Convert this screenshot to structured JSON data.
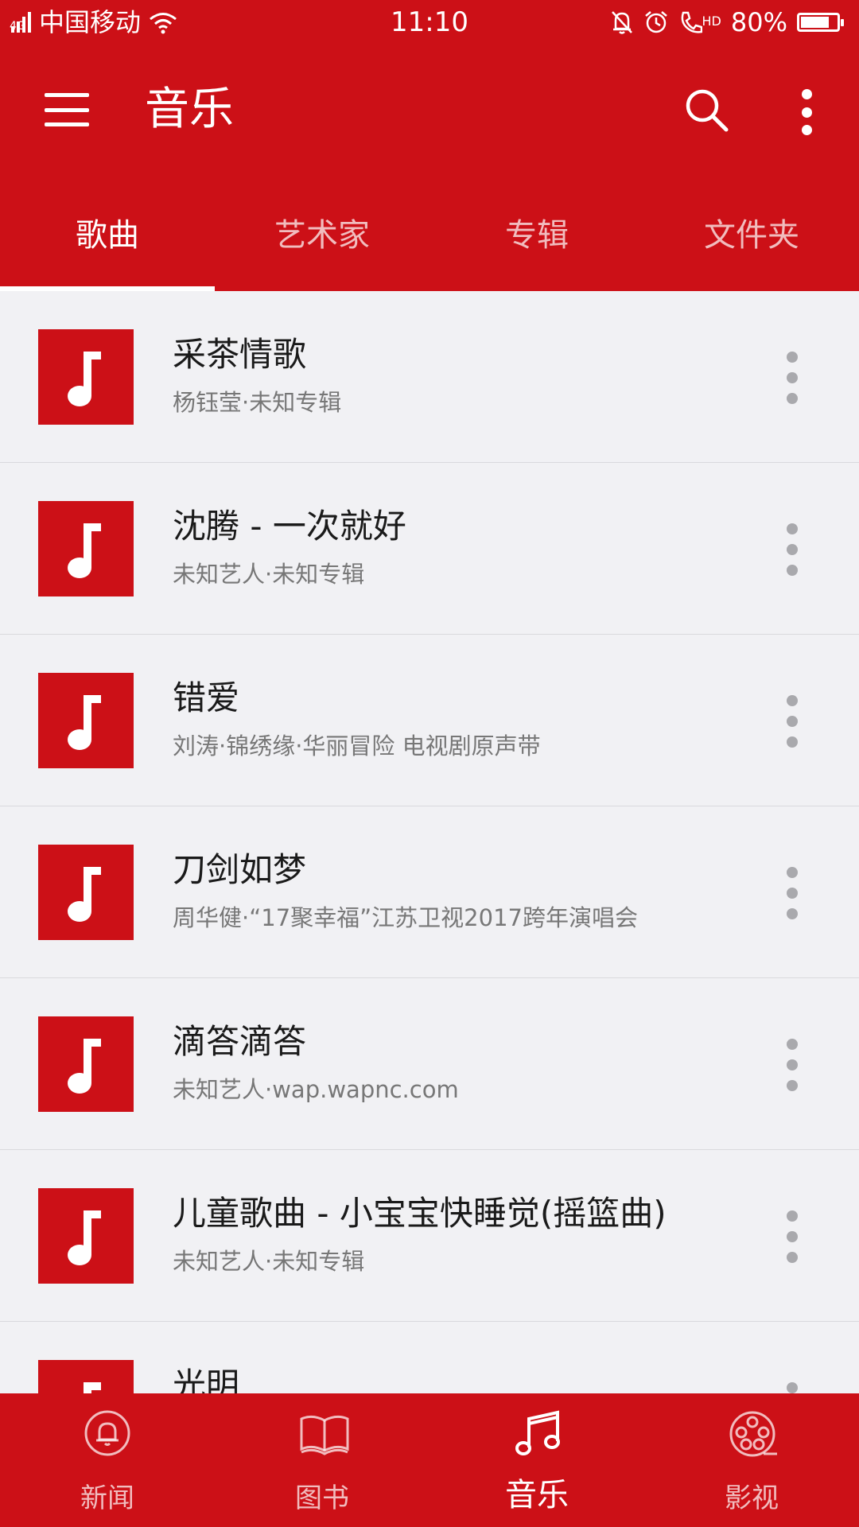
{
  "status_bar": {
    "network_type": "4G",
    "carrier": "中国移动",
    "time": "11:10",
    "hd_label": "HD",
    "battery": "80%",
    "battery_level": 0.8,
    "icons": [
      "signal-icon",
      "wifi-icon",
      "mute-bell-icon",
      "alarm-icon",
      "hd-call-icon",
      "battery-icon"
    ]
  },
  "app_bar": {
    "title": "音乐",
    "icons": [
      "menu-icon",
      "search-icon",
      "more-vertical-icon"
    ]
  },
  "tabs": [
    {
      "label": "歌曲",
      "active": true
    },
    {
      "label": "艺术家",
      "active": false
    },
    {
      "label": "专辑",
      "active": false
    },
    {
      "label": "文件夹",
      "active": false
    }
  ],
  "songs": [
    {
      "title": "采茶情歌",
      "subtitle": "杨钰莹·未知专辑"
    },
    {
      "title": "沈腾 - 一次就好",
      "subtitle": "未知艺人·未知专辑"
    },
    {
      "title": "错爱",
      "subtitle": "刘涛·锦绣缘·华丽冒险 电视剧原声带"
    },
    {
      "title": "刀剑如梦",
      "subtitle": "周华健·“17聚幸福”江苏卫视2017跨年演唱会"
    },
    {
      "title": "滴答滴答",
      "subtitle": "未知艺人·wap.wapnc.com"
    },
    {
      "title": "儿童歌曲 - 小宝宝快睡觉(摇篮曲)",
      "subtitle": "未知艺人·未知专辑"
    },
    {
      "title": "光明",
      "subtitle": ""
    }
  ],
  "bottom_nav": [
    {
      "label": "新闻",
      "icon": "news-bell-icon",
      "active": false
    },
    {
      "label": "图书",
      "icon": "book-icon",
      "active": false
    },
    {
      "label": "音乐",
      "icon": "music-note-icon",
      "active": true
    },
    {
      "label": "影视",
      "icon": "film-reel-icon",
      "active": false
    }
  ],
  "colors": {
    "primary": "#cc1017",
    "list_background": "#f1f1f4",
    "title_text": "#1a1a1a",
    "subtitle_text": "#777777"
  }
}
